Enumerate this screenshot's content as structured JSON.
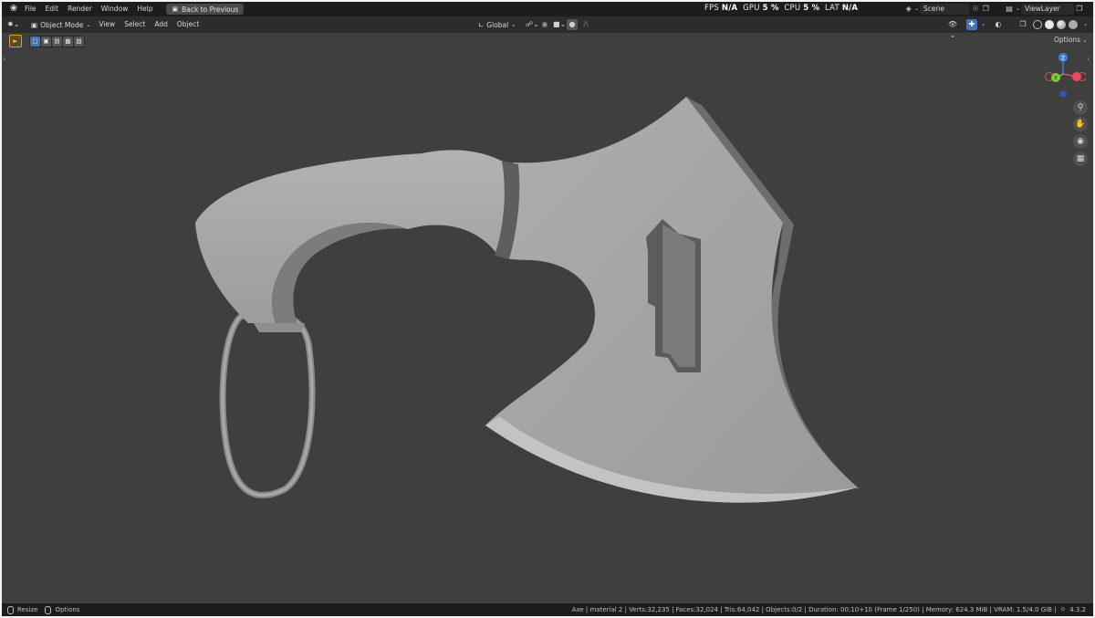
{
  "topbar": {
    "menus": [
      "File",
      "Edit",
      "Render",
      "Window",
      "Help"
    ],
    "back_button": "Back to Previous",
    "scene": "Scene",
    "view_layer": "ViewLayer"
  },
  "header": {
    "mode": "Object Mode",
    "menus": [
      "View",
      "Select",
      "Add",
      "Object"
    ],
    "orientation": "Global"
  },
  "stats": {
    "fps_label": "FPS",
    "fps_value": "N/A",
    "gpu_label": "GPU",
    "gpu_value": "5 %",
    "cpu_label": "CPU",
    "cpu_value": "5 %",
    "lat_label": "LAT",
    "lat_value": "N/A"
  },
  "viewport": {
    "options_label": "Options",
    "gizmo_axes": {
      "x": "X",
      "y": "Y",
      "z": "Z"
    },
    "colors": {
      "x_axis": "#e64a5c",
      "y_axis": "#80c63a",
      "z_axis": "#3e7fd6",
      "background": "#3f3f3f"
    }
  },
  "statusbar": {
    "resize_label": "Resize",
    "options_label": "Options",
    "info": "Axe | material 2 | Verts:32,235 | Faces:32,024 | Tris:64,042 | Objects:0/2 | Duration: 00:10+10 (Frame 1/250) | Memory: 624.3 MiB | VRAM: 1.5/4.0 GiB |",
    "version": "4.3.2"
  }
}
